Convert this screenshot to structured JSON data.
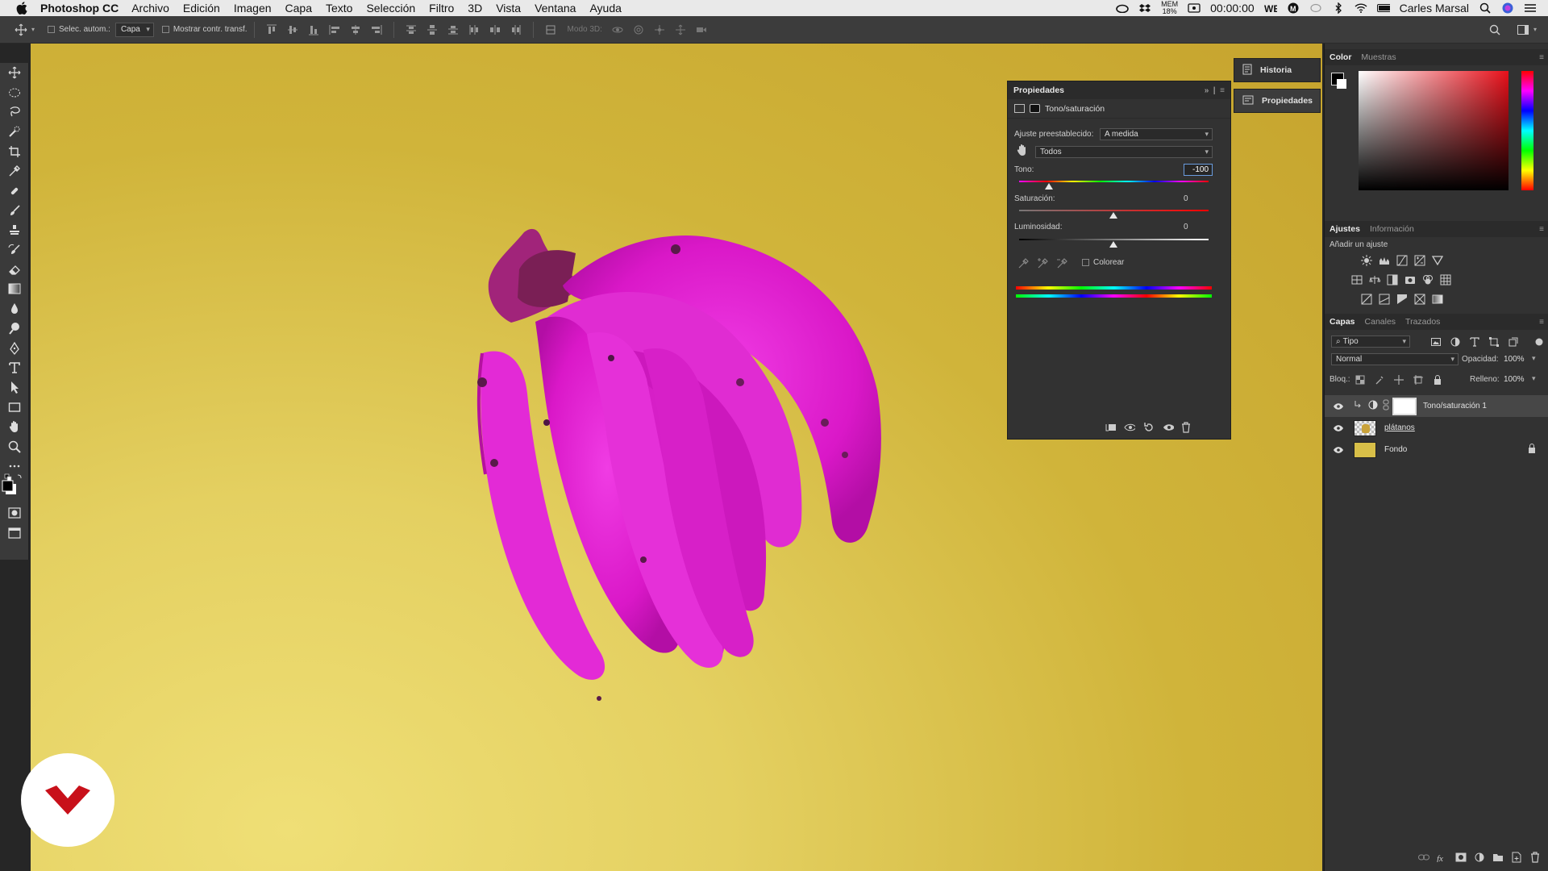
{
  "menubar": {
    "app_name": "Photoshop CC",
    "items": [
      "Archivo",
      "Edición",
      "Imagen",
      "Capa",
      "Texto",
      "Selección",
      "Filtro",
      "3D",
      "Vista",
      "Ventana",
      "Ayuda"
    ],
    "mem_label": "MEM",
    "mem_value": "18%",
    "timer": "00:00:00",
    "user": "Carles Marsal"
  },
  "optionsbar": {
    "auto_select_label": "Selec. autom.:",
    "auto_select_value": "Capa",
    "show_transform_label": "Mostrar contr. transf.",
    "mode3d_label": "Modo 3D:"
  },
  "properties": {
    "title": "Propiedades",
    "subtitle": "Tono/saturación",
    "preset_label": "Ajuste preestablecido:",
    "preset_value": "A medida",
    "channel_value": "Todos",
    "hue_label": "Tono:",
    "hue_value": "-100",
    "saturation_label": "Saturación:",
    "saturation_value": "0",
    "lightness_label": "Luminosidad:",
    "lightness_value": "0",
    "colorize_label": "Colorear"
  },
  "dock": {
    "history_label": "Historia",
    "properties_label": "Propiedades"
  },
  "color_panel": {
    "tabs": [
      "Color",
      "Muestras"
    ],
    "hue_color": "#e8101a"
  },
  "adjustments_panel": {
    "tabs": [
      "Ajustes",
      "Información"
    ],
    "add_label": "Añadir un ajuste"
  },
  "layers_panel": {
    "tabs": [
      "Capas",
      "Canales",
      "Trazados"
    ],
    "filter_value": "Tipo",
    "blend_mode": "Normal",
    "opacity_label": "Opacidad:",
    "opacity_value": "100%",
    "lock_label": "Bloq.:",
    "fill_label": "Relleno:",
    "fill_value": "100%",
    "layers": [
      {
        "name": "Tono/saturación 1"
      },
      {
        "name": "plátanos"
      },
      {
        "name": "Fondo"
      }
    ]
  },
  "colors": {
    "banana": "#e020d0",
    "background_yellow": "#d8c04a"
  }
}
